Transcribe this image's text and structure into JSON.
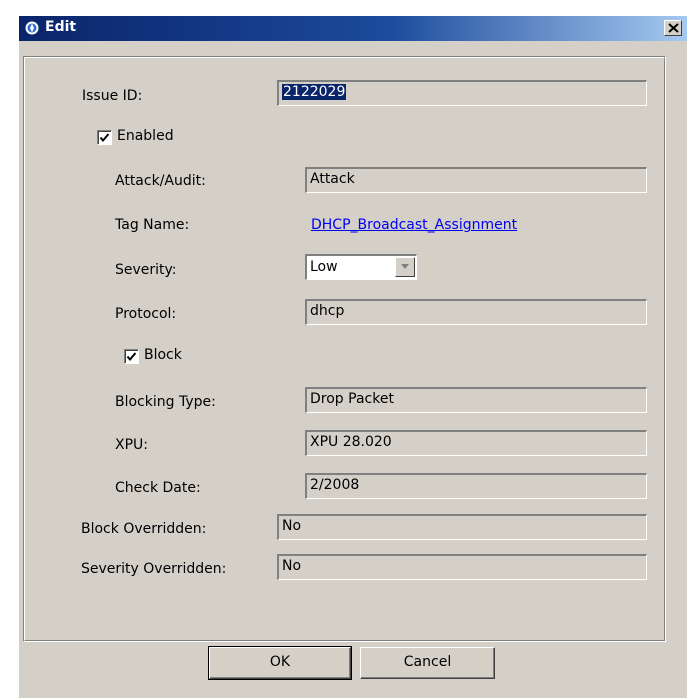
{
  "window": {
    "title": "Edit"
  },
  "form": {
    "issue_id": {
      "label": "Issue ID:",
      "value": "2122029"
    },
    "enabled": {
      "label": "Enabled",
      "checked": true
    },
    "attack_audit": {
      "label": "Attack/Audit:",
      "value": "Attack"
    },
    "tag_name": {
      "label": "Tag Name:",
      "value": "DHCP_Broadcast_Assignment"
    },
    "severity": {
      "label": "Severity:",
      "value": "Low"
    },
    "protocol": {
      "label": "Protocol:",
      "value": "dhcp"
    },
    "block": {
      "label": "Block",
      "checked": true
    },
    "blocking_type": {
      "label": "Blocking Type:",
      "value": "Drop Packet"
    },
    "xpu": {
      "label": "XPU:",
      "value": "XPU 28.020"
    },
    "check_date": {
      "label": "Check Date:",
      "value": "2/2008"
    },
    "block_overridden": {
      "label": "Block Overridden:",
      "value": "No"
    },
    "severity_overridden": {
      "label": "Severity Overridden:",
      "value": "No"
    }
  },
  "buttons": {
    "ok": "OK",
    "cancel": "Cancel"
  },
  "icons": {
    "app": "app-icon",
    "close": "close-icon",
    "check": "check-icon",
    "dropdown": "chevron-down-icon"
  },
  "colors": {
    "title_bar": "#0a246a",
    "dialog_bg": "#d4d0c8",
    "link": "#0000ee",
    "selection": "#0a246a"
  }
}
